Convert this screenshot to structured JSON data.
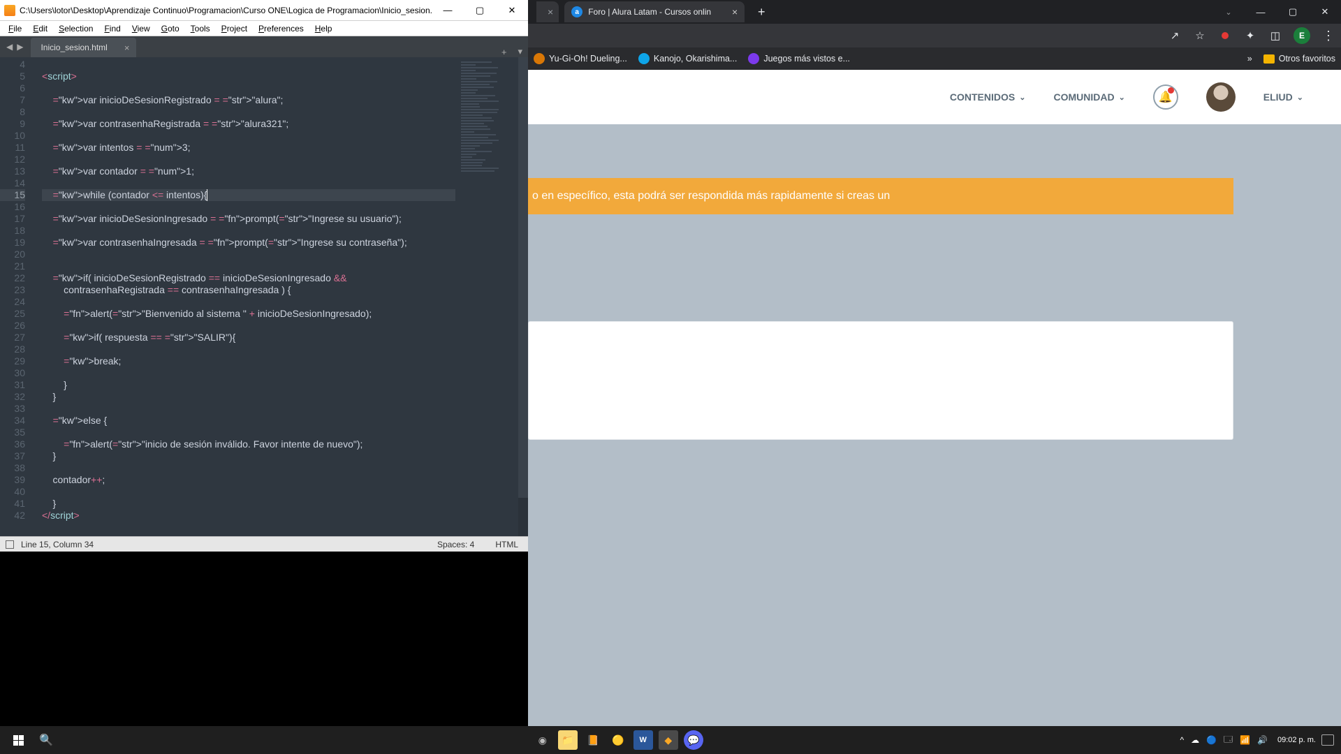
{
  "sublime": {
    "title": "C:\\Users\\lotor\\Desktop\\Aprendizaje Continuo\\Programacion\\Curso ONE\\Logica de Programacion\\Inicio_sesion.html...",
    "menu": [
      "File",
      "Edit",
      "Selection",
      "Find",
      "View",
      "Goto",
      "Tools",
      "Project",
      "Preferences",
      "Help"
    ],
    "tab": "Inicio_sesion.html",
    "statusbar": {
      "pos": "Line 15, Column 34",
      "spaces": "Spaces: 4",
      "lang": "HTML"
    },
    "code": {
      "first_line_no": 4,
      "highlight_line": 15,
      "lines": [
        {
          "n": 4,
          "t": ""
        },
        {
          "n": 5,
          "t": "<script>",
          "kind": "open"
        },
        {
          "n": 6,
          "t": ""
        },
        {
          "n": 7,
          "t": "    var inicioDeSesionRegistrado = \"alura\";"
        },
        {
          "n": 8,
          "t": ""
        },
        {
          "n": 9,
          "t": "    var contrasenhaRegistrada = \"alura321\";"
        },
        {
          "n": 10,
          "t": ""
        },
        {
          "n": 11,
          "t": "    var intentos = 3;"
        },
        {
          "n": 12,
          "t": ""
        },
        {
          "n": 13,
          "t": "    var contador = 1;"
        },
        {
          "n": 14,
          "t": ""
        },
        {
          "n": 15,
          "t": "    while (contador <= intentos){"
        },
        {
          "n": 16,
          "t": ""
        },
        {
          "n": 17,
          "t": "    var inicioDeSesionIngresado = prompt(\"Ingrese su usuario\");"
        },
        {
          "n": 18,
          "t": ""
        },
        {
          "n": 19,
          "t": "    var contrasenhaIngresada = prompt(\"Ingrese su contraseña\");"
        },
        {
          "n": 20,
          "t": ""
        },
        {
          "n": 21,
          "t": ""
        },
        {
          "n": 22,
          "t": "    if( inicioDeSesionRegistrado == inicioDeSesionIngresado &&"
        },
        {
          "n": 23,
          "t": "        contrasenhaRegistrada == contrasenhaIngresada ) {"
        },
        {
          "n": 24,
          "t": ""
        },
        {
          "n": 25,
          "t": "        alert(\"Bienvenido al sistema \" + inicioDeSesionIngresado);"
        },
        {
          "n": 26,
          "t": ""
        },
        {
          "n": 27,
          "t": "        if( respuesta == \"SALIR\"){"
        },
        {
          "n": 28,
          "t": ""
        },
        {
          "n": 29,
          "t": "        break;"
        },
        {
          "n": 30,
          "t": ""
        },
        {
          "n": 31,
          "t": "        }"
        },
        {
          "n": 32,
          "t": "    }"
        },
        {
          "n": 33,
          "t": ""
        },
        {
          "n": 34,
          "t": "    else {"
        },
        {
          "n": 35,
          "t": ""
        },
        {
          "n": 36,
          "t": "        alert(\"inicio de sesión inválido. Favor intente de nuevo\");"
        },
        {
          "n": 37,
          "t": "    }"
        },
        {
          "n": 38,
          "t": ""
        },
        {
          "n": 39,
          "t": "    contador++;"
        },
        {
          "n": 40,
          "t": ""
        },
        {
          "n": 41,
          "t": "    }"
        },
        {
          "n": 42,
          "t": "</script>",
          "kind": "close"
        }
      ]
    }
  },
  "chrome": {
    "tabs": {
      "frag_close_visible": true,
      "active_title": "Foro | Alura Latam - Cursos onlin",
      "favicon_letter": "a"
    },
    "bookmarks": [
      {
        "label": "Yu-Gi-Oh! Dueling...",
        "color": "#d97706"
      },
      {
        "label": "Kanojo, Okarishima...",
        "color": "#0ea5e9"
      },
      {
        "label": "Juegos más vistos e...",
        "color": "#7c3aed"
      }
    ],
    "bookmarks_more": "»",
    "bookmarks_folder": "Otros favoritos",
    "header": {
      "menu": [
        {
          "label": "CONTENIDOS"
        },
        {
          "label": "COMUNIDAD"
        }
      ],
      "username": "ELIUD"
    },
    "avatar_initial": "E",
    "banner_text": "o en específico, esta podrá ser respondida más rapidamente si creas un"
  },
  "taskbar": {
    "time": "09:02 p. m.",
    "tray_icons": [
      "^",
      "☁",
      "🔵",
      "🗔",
      "📶",
      "🔊"
    ]
  }
}
